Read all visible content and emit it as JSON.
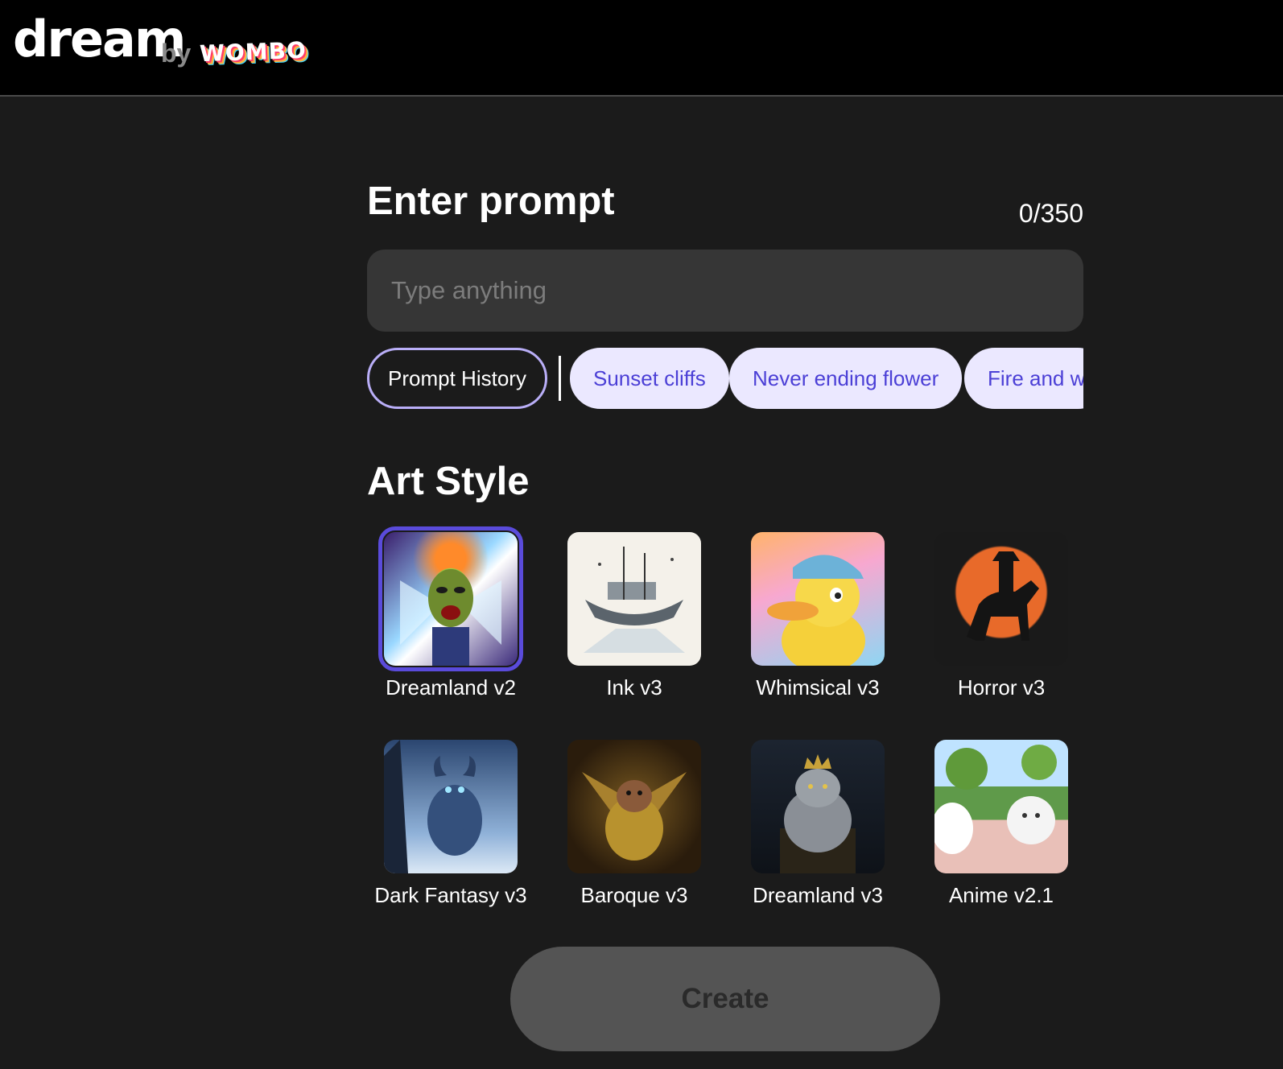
{
  "brand": {
    "name": "dream",
    "by": "by",
    "partner": "WOMBO"
  },
  "prompt": {
    "heading": "Enter prompt",
    "counter": "0/350",
    "placeholder": "Type anything",
    "value": ""
  },
  "chips": {
    "history_label": "Prompt History",
    "suggestions": [
      "Sunset cliffs",
      "Never ending flower",
      "Fire and w"
    ]
  },
  "art_style": {
    "heading": "Art Style",
    "selected": "Dreamland v2",
    "styles": [
      {
        "label": "Dreamland v2",
        "icon": "screaming-creature-thumbnail"
      },
      {
        "label": "Ink v3",
        "icon": "ink-ship-thumbnail"
      },
      {
        "label": "Whimsical v3",
        "icon": "duck-with-cap-thumbnail"
      },
      {
        "label": "Horror v3",
        "icon": "horseman-silhouette-thumbnail"
      },
      {
        "label": "Dark Fantasy v3",
        "icon": "ice-beast-thumbnail"
      },
      {
        "label": "Baroque v3",
        "icon": "bat-creature-thumbnail"
      },
      {
        "label": "Dreamland v3",
        "icon": "crowned-cat-thumbnail"
      },
      {
        "label": "Anime v2.1",
        "icon": "white-cats-thumbnail"
      }
    ]
  },
  "actions": {
    "create_label": "Create"
  },
  "colors": {
    "background": "#1b1b1b",
    "header": "#000000",
    "accent": "#5a4bdb",
    "chip_bg": "#ebe8ff",
    "chip_text": "#4b3fd6",
    "input_bg": "#363636",
    "button_disabled": "#545454"
  }
}
